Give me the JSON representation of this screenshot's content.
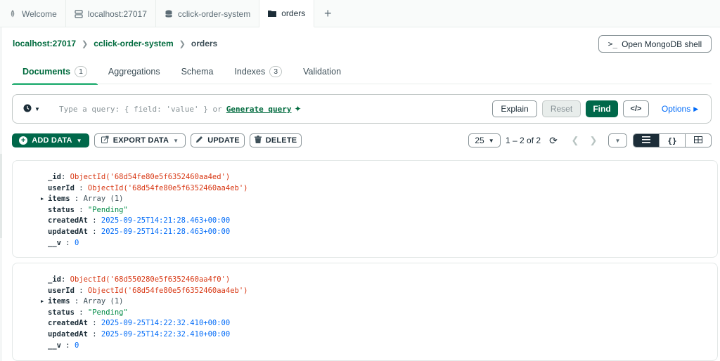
{
  "tabs": [
    {
      "label": "Welcome",
      "icon": "leaf-icon"
    },
    {
      "label": "localhost:27017",
      "icon": "server-icon"
    },
    {
      "label": "cclick-order-system",
      "icon": "database-icon"
    },
    {
      "label": "orders",
      "icon": "folder-icon"
    }
  ],
  "breadcrumb": {
    "host": "localhost:27017",
    "database": "cclick-order-system",
    "collection": "orders"
  },
  "shell_button": {
    "prompt": ">_",
    "label": "Open MongoDB shell"
  },
  "subtabs": [
    {
      "label": "Documents",
      "count": "1"
    },
    {
      "label": "Aggregations"
    },
    {
      "label": "Schema"
    },
    {
      "label": "Indexes",
      "count": "3"
    },
    {
      "label": "Validation"
    }
  ],
  "query": {
    "placeholder": "Type a query: { field: 'value' } or",
    "generate_label": "Generate query",
    "explain": "Explain",
    "reset": "Reset",
    "find": "Find",
    "code": "</>",
    "options": "Options"
  },
  "toolbar": {
    "add": "ADD DATA",
    "export": "EXPORT DATA",
    "update": "UPDATE",
    "delete": "DELETE"
  },
  "pager": {
    "page_size": "25",
    "range": "1 – 2 of 2"
  },
  "documents": [
    {
      "id": "ObjectId('68d54fe80e5f6352460aa4ed')",
      "userId": "ObjectId('68d54fe80e5f6352460aa4eb')",
      "items": "Array (1)",
      "status": "\"Pending\"",
      "createdAt": "2025-09-25T14:21:28.463+00:00",
      "updatedAt": "2025-09-25T14:21:28.463+00:00",
      "v": "0"
    },
    {
      "id": "ObjectId('68d550280e5f6352460aa4f0')",
      "userId": "ObjectId('68d54fe80e5f6352460aa4eb')",
      "items": "Array (1)",
      "status": "\"Pending\"",
      "createdAt": "2025-09-25T14:22:32.410+00:00",
      "updatedAt": "2025-09-25T14:22:32.410+00:00",
      "v": "0"
    }
  ],
  "field_keys": {
    "id": "_id",
    "userId": "userId",
    "items": "items",
    "status": "status",
    "createdAt": "createdAt",
    "updatedAt": "updatedAt",
    "v": "__v"
  },
  "colors": {
    "accent": "#00684a",
    "link": "#016bf8",
    "objectid": "#d83713",
    "string": "#008a45"
  }
}
